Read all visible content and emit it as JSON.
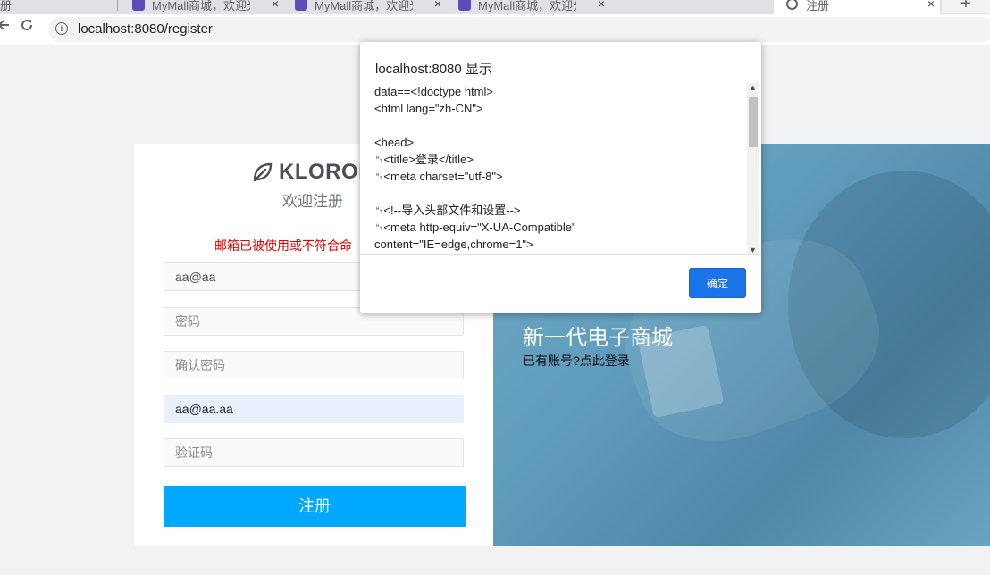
{
  "browser": {
    "tabs": [
      {
        "title": "册"
      },
      {
        "title": "MyMall商城，欢迎光"
      },
      {
        "title": "MyMall商城，欢迎光"
      },
      {
        "title": "MyMall商城，欢迎光"
      },
      {
        "title": "注册",
        "active": true
      }
    ],
    "close_glyph": "×",
    "new_tab_glyph": "+",
    "back_icon": "back-arrow-icon",
    "reload_icon": "reload-icon",
    "info_icon": "info-icon",
    "url": "localhost:8080/register"
  },
  "page": {
    "brand": "KLOROF",
    "subtitle": "欢迎注册",
    "error_message": "邮箱已被使用或不符合命",
    "fields": {
      "email_value": "aa@aa",
      "password_placeholder": "密码",
      "confirm_password_placeholder": "确认密码",
      "autofill_value": "aa@aa.aa",
      "captcha_placeholder": "验证码"
    },
    "submit_label": "注册",
    "hero_title": "新一代电子商城",
    "hero_login_link": "已有账号?点此登录",
    "colors": {
      "submit": "#00a8ff",
      "error": "#e00000",
      "hero": "#5f9bbb"
    }
  },
  "alert": {
    "title": "localhost:8080 显示",
    "message": "data==<!doctype html>\n<html lang=\"zh-CN\">\n\n<head>\n␉<title>登录</title>\n␉<meta charset=\"utf-8\">\n\n␉<!--导入头部文件和设置-->\n␉<meta http-equiv=\"X-UA-Compatible\"\ncontent=\"IE=edge,chrome=1\">",
    "ok_label": "确定"
  }
}
